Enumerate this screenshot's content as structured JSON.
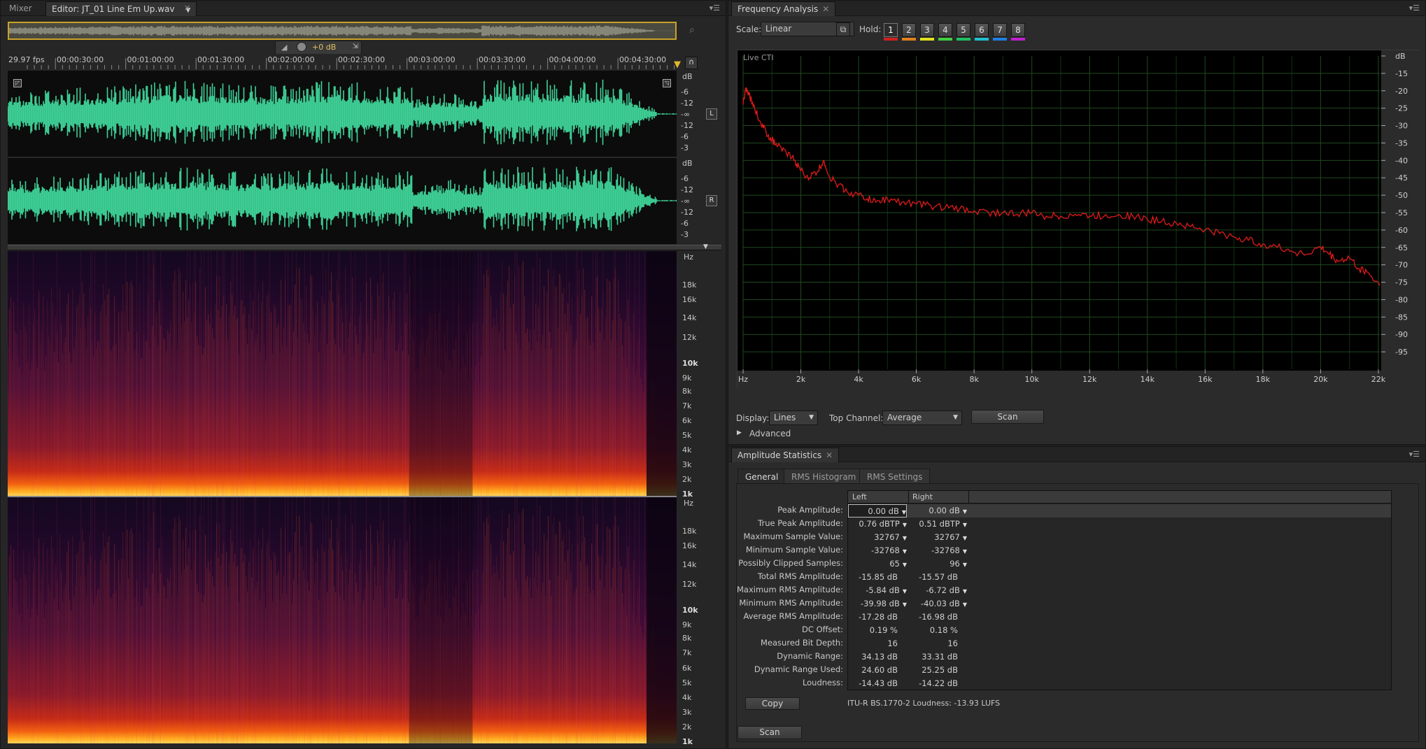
{
  "editor": {
    "tabs": [
      {
        "label": "Mixer"
      },
      {
        "label": "Editor: JT_01 Line Em Up.wav"
      }
    ],
    "hud_gain": "+0 dB",
    "fps": "29.97 fps",
    "timecodes": [
      "00:00:30:00",
      "00:01:00:00",
      "00:01:30:00",
      "00:02:00:00",
      "00:02:30:00",
      "00:03:00:00",
      "00:03:30:00",
      "00:04:00:00",
      "00:04:30:00"
    ],
    "db_scale_label": "dB",
    "db_ticks": [
      "-6",
      "-12",
      "-∞",
      "-12",
      "-6",
      "-3"
    ],
    "channel_left": "L",
    "channel_right": "R",
    "hz_label": "Hz",
    "hz_ticks": [
      "18k",
      "16k",
      "14k",
      "12k",
      "10k",
      "9k",
      "8k",
      "7k",
      "6k",
      "5k",
      "4k",
      "3k",
      "2k",
      "1k"
    ],
    "waveform_color": "#3fd398"
  },
  "freq": {
    "panel_title": "Frequency Analysis",
    "scale_label": "Scale:",
    "scale_value": "Linear",
    "hold_label": "Hold:",
    "hold_buttons": [
      {
        "label": "1",
        "color": "#d02020"
      },
      {
        "label": "2",
        "color": "#e08020"
      },
      {
        "label": "3",
        "color": "#e0e020"
      },
      {
        "label": "4",
        "color": "#40d040"
      },
      {
        "label": "5",
        "color": "#20c060"
      },
      {
        "label": "6",
        "color": "#20c0d0"
      },
      {
        "label": "7",
        "color": "#2080e0"
      },
      {
        "label": "8",
        "color": "#c020d0"
      }
    ],
    "graph_label": "Live CTI",
    "display_label": "Display:",
    "display_value": "Lines",
    "top_channel_label": "Top Channel:",
    "top_channel_value": "Average",
    "scan_label": "Scan",
    "advanced_label": "Advanced"
  },
  "chart_data": {
    "type": "line",
    "title": "",
    "xlabel": "Hz",
    "ylabel": "dB",
    "x_ticks": [
      "Hz",
      "2k",
      "4k",
      "6k",
      "8k",
      "10k",
      "12k",
      "14k",
      "16k",
      "18k",
      "20k",
      "22k"
    ],
    "y_ticks": [
      "dB",
      "-15",
      "-20",
      "-25",
      "-30",
      "-35",
      "-40",
      "-45",
      "-50",
      "-55",
      "-60",
      "-65",
      "-70",
      "-75",
      "-80",
      "-85",
      "-90",
      "-95"
    ],
    "xlim": [
      0,
      22050
    ],
    "ylim": [
      -100,
      -10
    ],
    "line_color": "#e01a1a",
    "grid": true,
    "series": [
      {
        "x": [
          0,
          100,
          200,
          400,
          600,
          800,
          1000,
          1200,
          1500,
          1800,
          2000,
          2300,
          2600,
          2800,
          3000,
          3300,
          3600,
          4000,
          4300,
          4600,
          5000,
          5500,
          6000,
          6500,
          7000,
          7500,
          8000,
          8500,
          9000,
          9500,
          10000,
          10500,
          11000,
          11500,
          12000,
          12500,
          13000,
          13500,
          14000,
          14500,
          15000,
          15500,
          16000,
          16500,
          17000,
          17500,
          18000,
          18500,
          19000,
          19500,
          20000,
          20300,
          20600,
          21000,
          21300,
          21600,
          22050
        ],
        "y": [
          -24,
          -19,
          -21,
          -25,
          -29,
          -32,
          -34,
          -36,
          -38,
          -40,
          -43,
          -45,
          -43,
          -40,
          -45,
          -47,
          -49,
          -50,
          -51,
          -52,
          -51,
          -52,
          -52.5,
          -53,
          -53.5,
          -54,
          -54.5,
          -55,
          -55,
          -55.5,
          -55,
          -56,
          -56,
          -55.5,
          -56,
          -56,
          -55.5,
          -56,
          -57,
          -57.5,
          -58,
          -59,
          -60,
          -61,
          -62,
          -63,
          -64,
          -65,
          -66,
          -67,
          -65,
          -67,
          -69,
          -68,
          -71,
          -72,
          -76
        ]
      }
    ]
  },
  "amp": {
    "panel_title": "Amplitude Statistics",
    "tabs": [
      "General",
      "RMS Histogram",
      "RMS Settings"
    ],
    "col_left": "Left",
    "col_right": "Right",
    "rows": [
      {
        "label": "Peak Amplitude:",
        "left": "0.00 dB",
        "right": "0.00 dB",
        "tri": true
      },
      {
        "label": "True Peak Amplitude:",
        "left": "0.76 dBTP",
        "right": "0.51 dBTP",
        "tri": true
      },
      {
        "label": "Maximum Sample Value:",
        "left": "32767",
        "right": "32767",
        "tri": true
      },
      {
        "label": "Minimum Sample Value:",
        "left": "-32768",
        "right": "-32768",
        "tri": true
      },
      {
        "label": "Possibly Clipped Samples:",
        "left": "65",
        "right": "96",
        "tri": true
      },
      {
        "label": "Total RMS Amplitude:",
        "left": "-15.85 dB",
        "right": "-15.57 dB",
        "tri": false
      },
      {
        "label": "Maximum RMS Amplitude:",
        "left": "-5.84 dB",
        "right": "-6.72 dB",
        "tri": true
      },
      {
        "label": "Minimum RMS Amplitude:",
        "left": "-39.98 dB",
        "right": "-40.03 dB",
        "tri": true
      },
      {
        "label": "Average RMS Amplitude:",
        "left": "-17.28 dB",
        "right": "-16.98 dB",
        "tri": false
      },
      {
        "label": "DC Offset:",
        "left": "0.19 %",
        "right": "0.18 %",
        "tri": false
      },
      {
        "label": "Measured Bit Depth:",
        "left": "16",
        "right": "16",
        "tri": false
      },
      {
        "label": "Dynamic Range:",
        "left": "34.13 dB",
        "right": "33.31 dB",
        "tri": false
      },
      {
        "label": "Dynamic Range Used:",
        "left": "24.60 dB",
        "right": "25.25 dB",
        "tri": false
      },
      {
        "label": "Loudness:",
        "left": "-14.43 dB",
        "right": "-14.22 dB",
        "tri": false
      }
    ],
    "copy_label": "Copy",
    "itu_text": "ITU-R BS.1770-2 Loudness: -13.93 LUFS",
    "scan_label": "Scan"
  }
}
